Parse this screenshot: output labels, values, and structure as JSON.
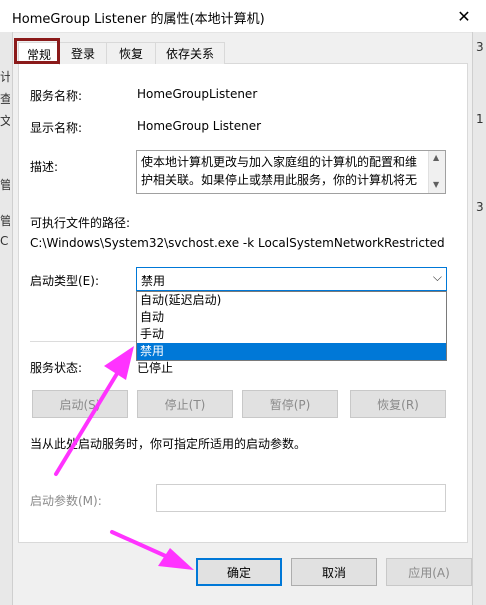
{
  "window": {
    "title": "HomeGroup Listener 的属性(本地计算机)"
  },
  "background_fragments": {
    "left": [
      "计",
      "查",
      "文",
      "管",
      "管",
      "C"
    ],
    "right": [
      "3",
      "1",
      "3"
    ]
  },
  "tabs": [
    {
      "label": "常规",
      "active": true
    },
    {
      "label": "登录",
      "active": false
    },
    {
      "label": "恢复",
      "active": false
    },
    {
      "label": "依存关系",
      "active": false
    }
  ],
  "general": {
    "service_name_label": "服务名称:",
    "service_name": "HomeGroupListener",
    "display_name_label": "显示名称:",
    "display_name": "HomeGroup Listener",
    "description_label": "描述:",
    "description": "使本地计算机更改与加入家庭组的计算机的配置和维护相关联。如果停止或禁用此服务，你的计算机将无法在",
    "exe_path_label": "可执行文件的路径:",
    "exe_path": "C:\\Windows\\System32\\svchost.exe -k LocalSystemNetworkRestricted",
    "startup_type_label": "启动类型(E):",
    "startup_type_value": "禁用",
    "startup_options": [
      "自动(延迟启动)",
      "自动",
      "手动",
      "禁用"
    ],
    "service_status_label": "服务状态:",
    "service_status_value": "已停止",
    "start_button": "启动(S)",
    "stop_button": "停止(T)",
    "pause_button": "暂停(P)",
    "resume_button": "恢复(R)",
    "hint": "当从此处启动服务时，你可指定所适用的启动参数。",
    "start_params_label": "启动参数(M):",
    "start_params_value": ""
  },
  "footer": {
    "ok": "确定",
    "cancel": "取消",
    "apply": "应用(A)"
  },
  "colors": {
    "accent": "#0078d7",
    "annotation_arrow": "#ff33ff",
    "tab_highlight": "#8b1a1a"
  }
}
